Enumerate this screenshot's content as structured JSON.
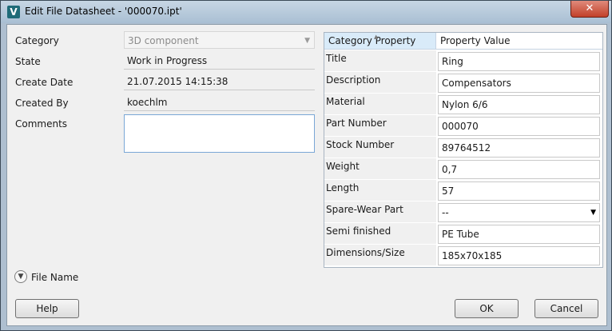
{
  "window": {
    "title": "Edit File Datasheet - '000070.ipt'",
    "app_icon_letter": "V",
    "close_glyph": "✕"
  },
  "form": {
    "category_label": "Category",
    "category_value": "3D component",
    "state_label": "State",
    "state_value": "Work in Progress",
    "create_date_label": "Create Date",
    "create_date_value": "21.07.2015 14:15:38",
    "created_by_label": "Created By",
    "created_by_value": "koechlm",
    "comments_label": "Comments",
    "comments_value": ""
  },
  "grid": {
    "headers": [
      "Category Property",
      "Property Value"
    ],
    "rows": [
      {
        "property": "Title",
        "value": "Ring"
      },
      {
        "property": "Description",
        "value": "Compensators"
      },
      {
        "property": "Material",
        "value": "Nylon 6/6"
      },
      {
        "property": "Part Number",
        "value": "000070"
      },
      {
        "property": "Stock Number",
        "value": "89764512"
      },
      {
        "property": "Weight",
        "value": "0,7"
      },
      {
        "property": "Length",
        "value": "57"
      },
      {
        "property": "Spare-Wear Part",
        "value": "--"
      },
      {
        "property": "Semi finished",
        "value": "PE Tube"
      },
      {
        "property": "Dimensions/Size",
        "value": "185x70x185"
      }
    ]
  },
  "footer": {
    "file_name_label": "File Name",
    "help_label": "Help",
    "ok_label": "OK",
    "cancel_label": "Cancel"
  },
  "icons": {
    "app": "vault-app-icon",
    "close": "close-icon",
    "combo": "chevron-down-icon",
    "expander": "expand-circle-icon"
  },
  "colors": {
    "header_selected": "#d9ebf9",
    "focus_border": "#7aa7d6",
    "close_button": "#c2402a"
  }
}
